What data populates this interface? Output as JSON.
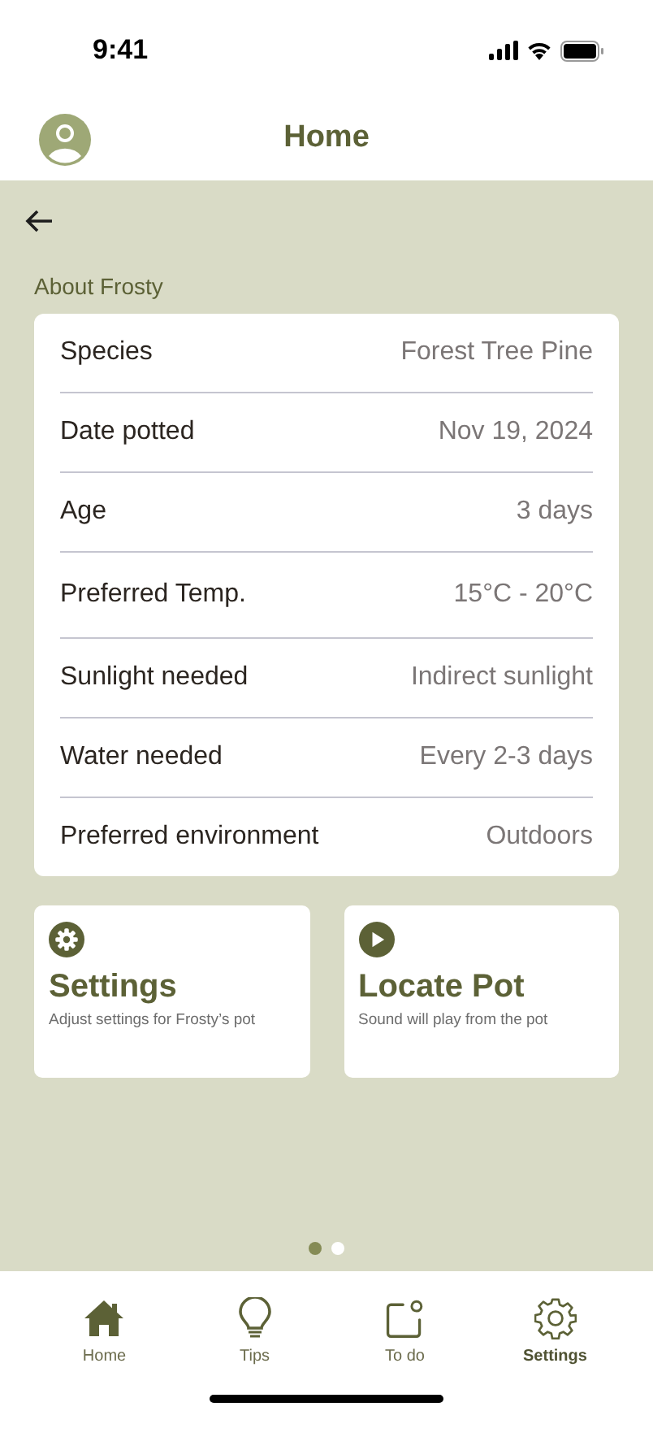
{
  "status_bar": {
    "time": "9:41"
  },
  "header": {
    "title": "Home"
  },
  "section_title": "About Frosty",
  "details": [
    {
      "label": "Species",
      "value": "Forest Tree Pine"
    },
    {
      "label": "Date potted",
      "value": "Nov 19, 2024"
    },
    {
      "label": "Age",
      "value": "3 days"
    },
    {
      "label": "Preferred Temp.",
      "value": "15°C - 20°C"
    },
    {
      "label": "Sunlight needed",
      "value": "Indirect sunlight"
    },
    {
      "label": "Water needed",
      "value": "Every 2-3 days"
    },
    {
      "label": "Preferred environment",
      "value": "Outdoors"
    }
  ],
  "actions": [
    {
      "kind": "settings",
      "title": "Settings",
      "subtitle": "Adjust settings for Frosty’s pot"
    },
    {
      "kind": "play",
      "title": "Locate Pot",
      "subtitle": "Sound will play from the pot"
    }
  ],
  "pager": [
    {
      "selected": true
    },
    {
      "selected": false
    }
  ],
  "tabs": [
    {
      "kind": "home",
      "label": "Home",
      "selected": false
    },
    {
      "kind": "tips",
      "label": "Tips",
      "selected": false
    },
    {
      "kind": "todo",
      "label": "To do",
      "selected": false
    },
    {
      "kind": "settings",
      "label": "Settings",
      "selected": true
    }
  ]
}
